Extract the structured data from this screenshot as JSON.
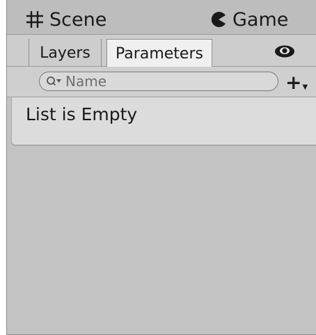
{
  "top_tabs": {
    "scene_label": "Scene",
    "game_label": "Game"
  },
  "sub_tabs": {
    "layers_label": "Layers",
    "parameters_label": "Parameters"
  },
  "search": {
    "placeholder": "Name",
    "value": ""
  },
  "add_label": "+",
  "list": {
    "empty_message": "List is Empty"
  },
  "icons": {
    "scene": "hash-grid-icon",
    "game": "pacman-icon",
    "visibility": "eye-icon",
    "search": "magnifier-dropdown-icon",
    "add": "plus-dropdown-icon"
  },
  "colors": {
    "panel_bg": "#c3c3c3",
    "active_tab_bg": "#f0f0f0",
    "list_bg": "#dcdcdc"
  }
}
